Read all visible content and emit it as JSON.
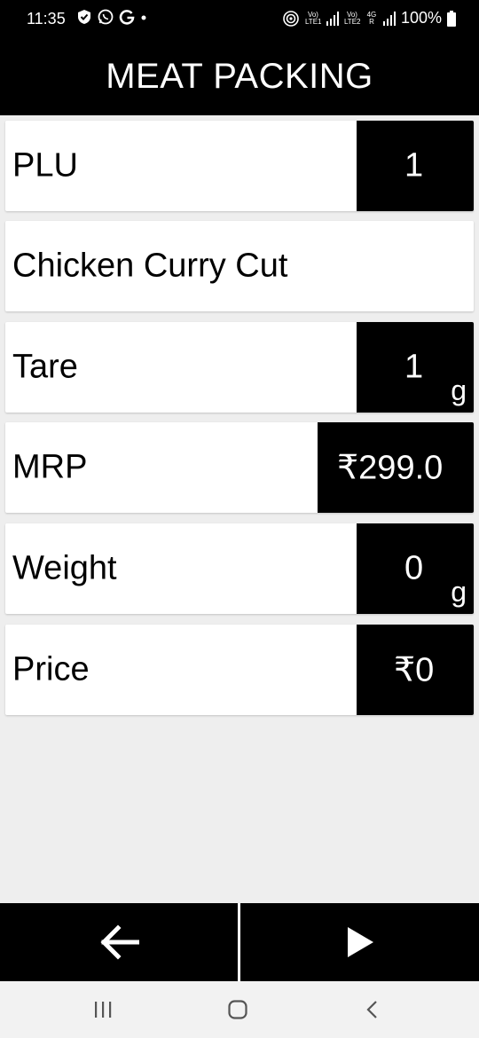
{
  "status_bar": {
    "time": "11:35",
    "left_icons": [
      "shield-check-icon",
      "whatsapp-icon",
      "google-icon",
      "dot-icon"
    ],
    "sim1_label": "Vo) LTE1",
    "sim2_label": "Vo) LTE2",
    "network_label": "4G R",
    "battery": "100%"
  },
  "header": {
    "title": "MEAT PACKING"
  },
  "fields": {
    "plu": {
      "label": "PLU",
      "value": "1"
    },
    "product_name": {
      "label": "Chicken Curry Cut"
    },
    "tare": {
      "label": "Tare",
      "value": "1",
      "unit": "g"
    },
    "mrp": {
      "label": "MRP",
      "value": "₹299.0"
    },
    "weight": {
      "label": "Weight",
      "value": "0",
      "unit": "g"
    },
    "price": {
      "label": "Price",
      "value": "₹0"
    }
  },
  "footer": {
    "back_icon": "arrow-left-icon",
    "next_icon": "play-icon"
  },
  "nav_bar": {
    "icons": [
      "recent-apps-icon",
      "home-icon",
      "back-icon"
    ]
  },
  "colors": {
    "header_bg": "#000000",
    "value_bg": "#000000",
    "row_bg": "#ffffff",
    "page_bg": "#eeeeee"
  }
}
